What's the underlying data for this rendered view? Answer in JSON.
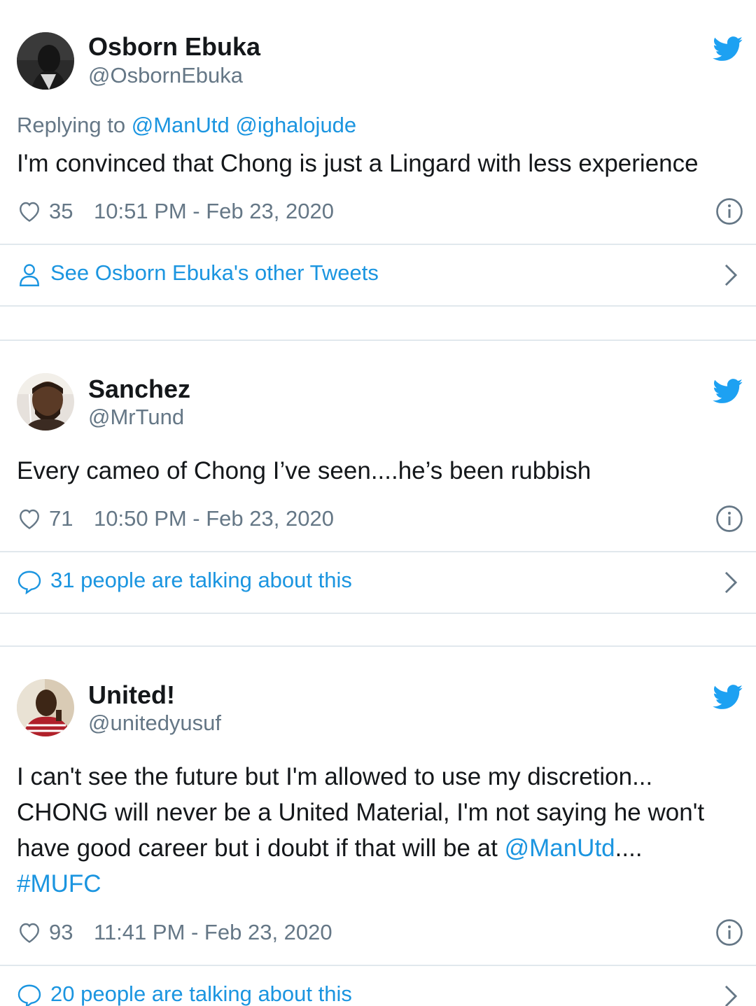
{
  "tweets": [
    {
      "name": "Osborn Ebuka",
      "handle": "@OsbornEbuka",
      "replying_prefix": "Replying to",
      "replying_to": "@ManUtd @ighalojude",
      "text": "I'm convinced that Chong is just a Lingard with less experience",
      "likes": "35",
      "timestamp": "10:51 PM - Feb 23, 2020",
      "action": "See Osborn Ebuka's other Tweets",
      "action_icon": "person-icon"
    },
    {
      "name": "Sanchez",
      "handle": "@MrTund",
      "text": "Every cameo of Chong I’ve seen....he’s been rubbish",
      "likes": "71",
      "timestamp": "10:50 PM - Feb 23, 2020",
      "action": "31 people are talking about this",
      "action_icon": "speech-bubble-icon"
    },
    {
      "name": "United!",
      "handle": "@unitedyusuf",
      "text_line1": "I can't see the future but I'm allowed to use my discretion...",
      "text_line2": "CHONG will never be a United Material, I'm not saying he won't",
      "text_line3_prefix": "have good career but i doubt if that will be at ",
      "text_line3_mention": "@ManUtd",
      "text_line3_suffix": "....",
      "hashtag": "#MUFC",
      "likes": "93",
      "timestamp": "11:41 PM - Feb 23, 2020",
      "action": "20 people are talking about this",
      "action_icon": "speech-bubble-icon"
    }
  ],
  "colors": {
    "link": "#1b95e0",
    "secondary_text": "#657786",
    "twitter_blue": "#1da1f2",
    "divider": "#e1e8ed"
  }
}
